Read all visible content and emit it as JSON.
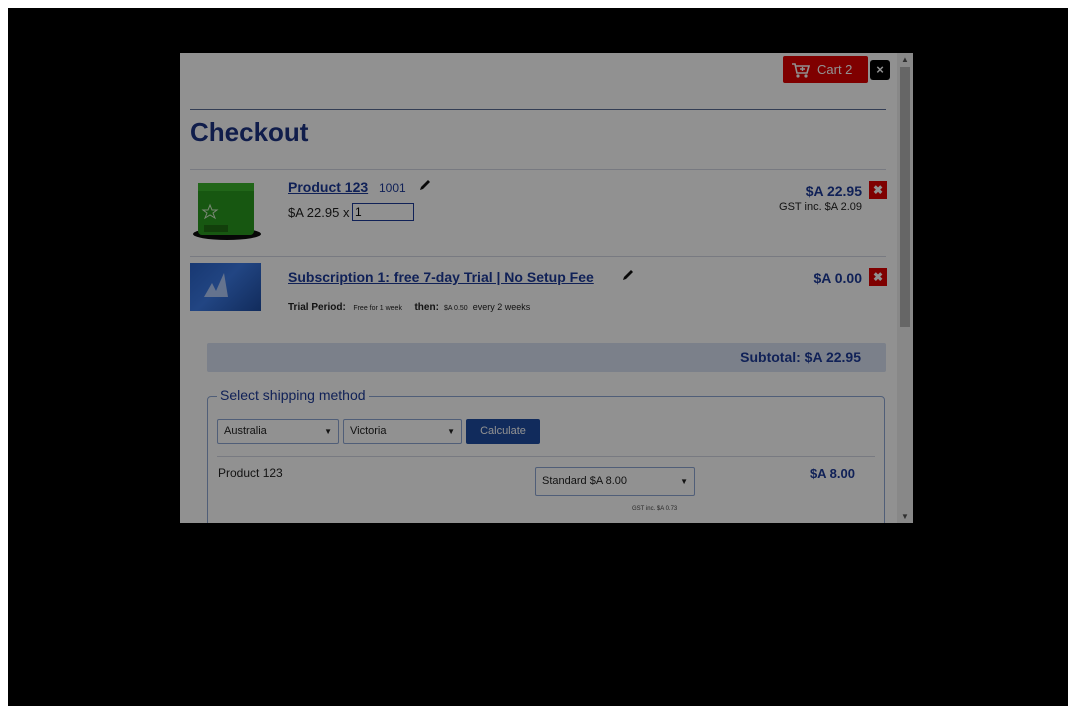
{
  "header": {
    "cart_label": "Cart 2",
    "close_label": "×"
  },
  "title": "Checkout",
  "items": [
    {
      "name": "Product 123",
      "code": "1001",
      "unit_price": "$A 22.95 x",
      "quantity": "1",
      "total": "$A 22.95",
      "gst": "GST inc. $A 2.09"
    },
    {
      "name": "Subscription 1: free 7-day Trial | No Setup Fee",
      "total": "$A 0.00",
      "trial_label": "Trial Period:",
      "trial_value": "Free for 1 week",
      "then_label": "then:",
      "then_price": "$A 0.50",
      "then_freq": "every 2 weeks"
    }
  ],
  "subtotal": "Subtotal: $A 22.95",
  "shipping": {
    "legend": "Select shipping method",
    "country": "Australia",
    "state": "Victoria",
    "calculate_label": "Calculate",
    "product": "Product 123",
    "method": "Standard $A 8.00",
    "price": "$A 8.00",
    "gst": "GST inc. $A 0.73"
  },
  "icons": {
    "cart": "cart-icon",
    "close": "close-icon",
    "edit": "pencil-icon",
    "remove": "remove-icon",
    "dropdown": "chevron-down-icon"
  },
  "colors": {
    "brand_blue": "#1d3a99",
    "cart_red": "#e00000",
    "overlay": "#000000",
    "subtotal_bg": "#d8e2f3"
  }
}
